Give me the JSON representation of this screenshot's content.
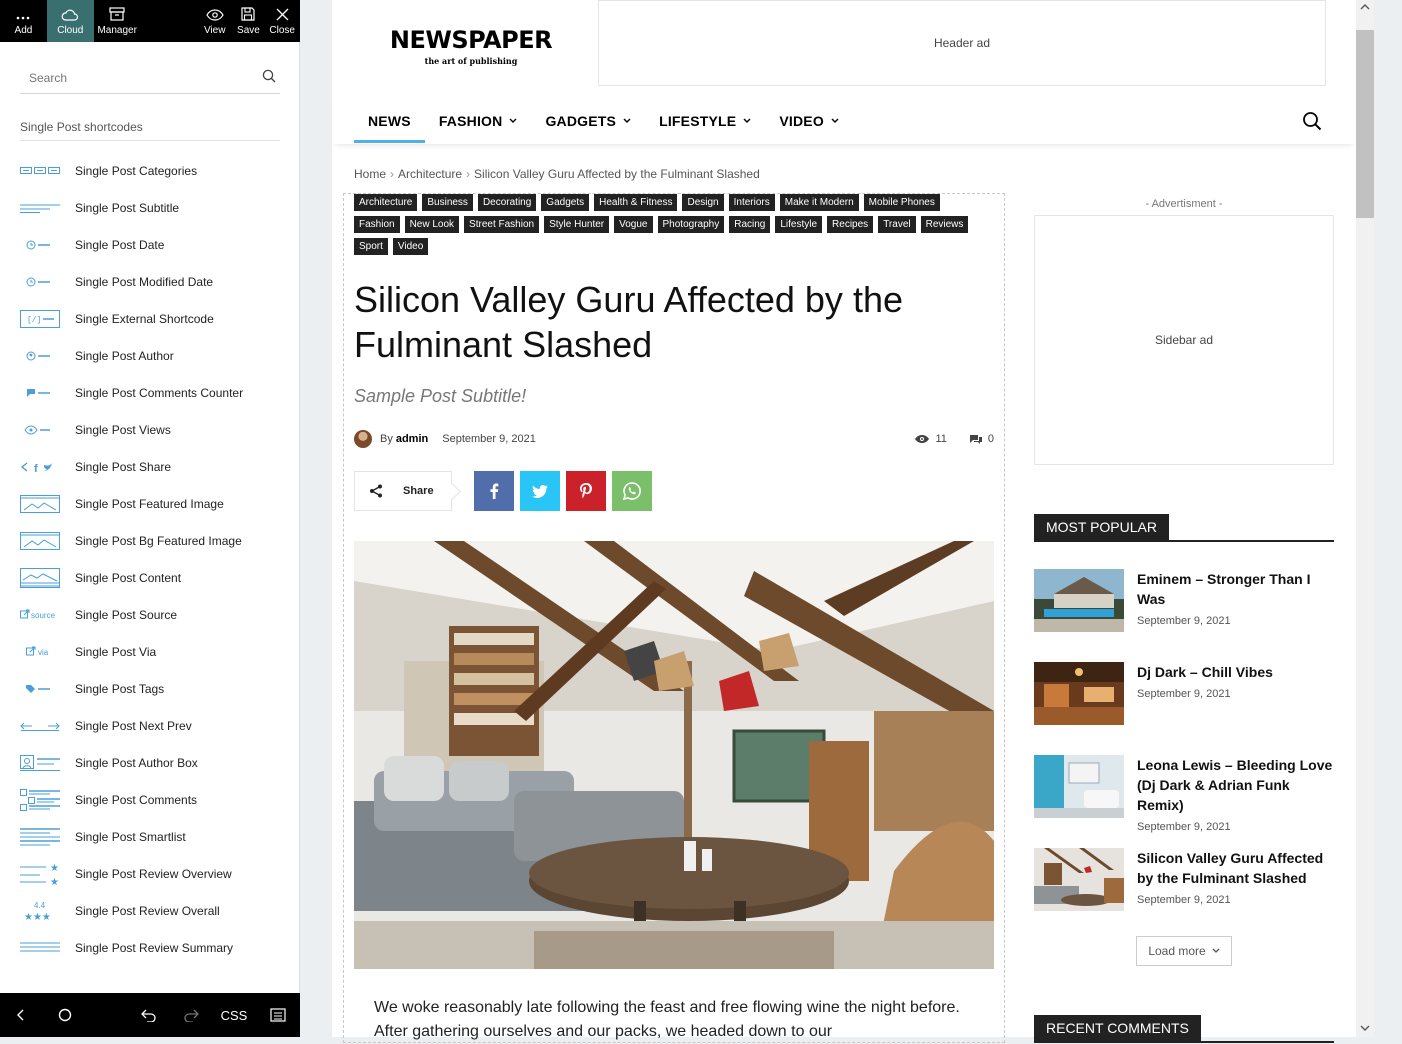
{
  "toolbar": {
    "add": "Add",
    "cloud": "Cloud",
    "manager": "Manager",
    "view": "View",
    "save": "Save",
    "close": "Close"
  },
  "panel": {
    "search_placeholder": "Search",
    "section_title": "Single Post shortcodes",
    "shortcodes": [
      {
        "label": "Single Post Categories",
        "icon": "categories-icon"
      },
      {
        "label": "Single Post Subtitle",
        "icon": "subtitle-icon"
      },
      {
        "label": "Single Post Date",
        "icon": "clock-icon"
      },
      {
        "label": "Single Post Modified Date",
        "icon": "clock-icon"
      },
      {
        "label": "Single External Shortcode",
        "icon": "shortcode-icon"
      },
      {
        "label": "Single Post Author",
        "icon": "author-icon"
      },
      {
        "label": "Single Post Comments Counter",
        "icon": "comments-icon"
      },
      {
        "label": "Single Post Views",
        "icon": "eye-icon"
      },
      {
        "label": "Single Post Share",
        "icon": "share-icon"
      },
      {
        "label": "Single Post Featured Image",
        "icon": "image-icon"
      },
      {
        "label": "Single Post Bg Featured Image",
        "icon": "image-icon"
      },
      {
        "label": "Single Post Content",
        "icon": "content-icon"
      },
      {
        "label": "Single Post Source",
        "icon": "source-icon"
      },
      {
        "label": "Single Post Via",
        "icon": "via-icon"
      },
      {
        "label": "Single Post Tags",
        "icon": "tag-icon"
      },
      {
        "label": "Single Post Next Prev",
        "icon": "next-prev-icon"
      },
      {
        "label": "Single Post Author Box",
        "icon": "author-box-icon"
      },
      {
        "label": "Single Post Comments",
        "icon": "comments-list-icon"
      },
      {
        "label": "Single Post Smartlist",
        "icon": "smartlist-icon"
      },
      {
        "label": "Single Post Review Overview",
        "icon": "review-overview-icon"
      },
      {
        "label": "Single Post Review Overall",
        "icon": "review-overall-icon"
      },
      {
        "label": "Single Post Review Summary",
        "icon": "review-summary-icon"
      }
    ],
    "source_icon_text": "source",
    "via_icon_text": "via",
    "review_number": "4.4"
  },
  "bottombar": {
    "css": "CSS"
  },
  "site": {
    "logo_title": "NEWSPAPER",
    "logo_tagline": "the art of publishing",
    "header_ad": "Header ad",
    "nav": [
      {
        "label": "NEWS",
        "dropdown": false
      },
      {
        "label": "FASHION",
        "dropdown": true
      },
      {
        "label": "GADGETS",
        "dropdown": true
      },
      {
        "label": "LIFESTYLE",
        "dropdown": true
      },
      {
        "label": "VIDEO",
        "dropdown": true
      }
    ],
    "accent_color": "#4db2ec"
  },
  "post": {
    "breadcrumb": [
      "Home",
      "Architecture",
      "Silicon Valley Guru Affected by the Fulminant Slashed"
    ],
    "categories": [
      "Architecture",
      "Business",
      "Decorating",
      "Gadgets",
      "Health & Fitness",
      "Design",
      "Interiors",
      "Make it Modern",
      "Mobile Phones",
      "Fashion",
      "New Look",
      "Street Fashion",
      "Style Hunter",
      "Vogue",
      "Photography",
      "Racing",
      "Lifestyle",
      "Recipes",
      "Travel",
      "Reviews",
      "Sport",
      "Video"
    ],
    "title": "Silicon Valley Guru Affected by the Fulminant Slashed",
    "subtitle": "Sample Post Subtitle!",
    "by": "By",
    "author": "admin",
    "date": "September 9, 2021",
    "views": "11",
    "comments": "0",
    "share_label": "Share",
    "share_colors": {
      "facebook": "#516eab",
      "twitter": "#29c5f6",
      "pinterest": "#ca212a",
      "whatsapp": "#7bbf6a"
    },
    "body": "We woke reasonably late following the feast and free flowing wine the night before. After gathering ourselves and our packs, we headed down to our"
  },
  "sidebar": {
    "ad_label": "- Advertisment -",
    "ad_text": "Sidebar ad",
    "most_popular_title": "MOST POPULAR",
    "popular": [
      {
        "title": "Eminem – Stronger Than I Was",
        "date": "September 9, 2021"
      },
      {
        "title": "Dj Dark – Chill Vibes",
        "date": "September 9, 2021"
      },
      {
        "title": "Leona Lewis – Bleeding Love (Dj Dark & Adrian Funk Remix)",
        "date": "September 9, 2021"
      },
      {
        "title": "Silicon Valley Guru Affected by the Fulminant Slashed",
        "date": "September 9, 2021"
      }
    ],
    "load_more": "Load more",
    "recent_comments_title": "RECENT COMMENTS"
  }
}
